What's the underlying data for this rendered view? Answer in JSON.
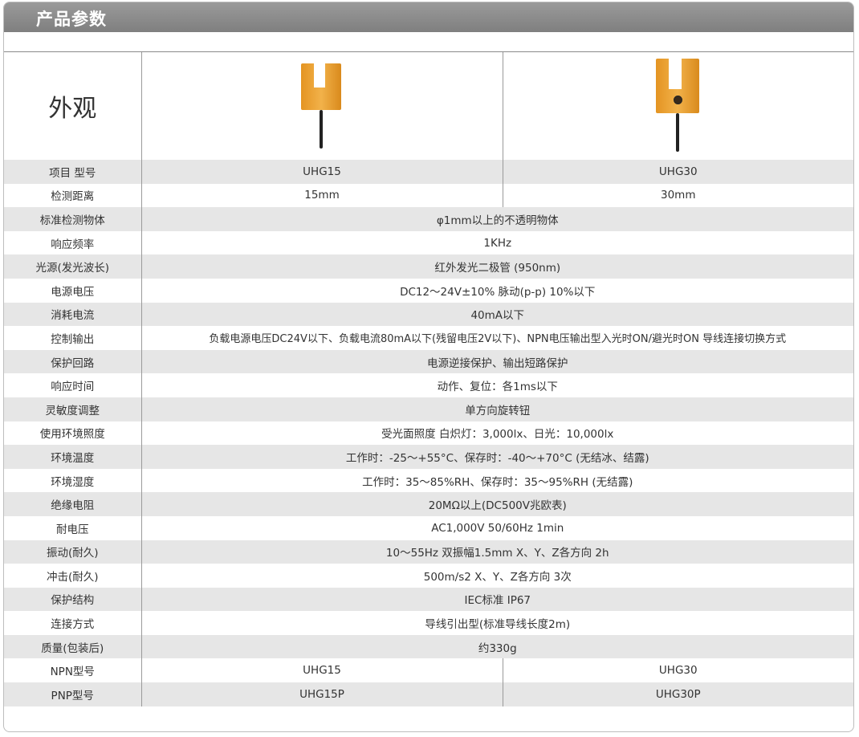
{
  "header": {
    "title": "产品参数"
  },
  "appearance": {
    "label": "外观",
    "product1_image": "u-slot-sensor-uhg15",
    "product2_image": "u-slot-sensor-uhg30"
  },
  "rows_split": [
    {
      "label": "项目 型号",
      "a": "UHG15",
      "b": "UHG30"
    },
    {
      "label": "检测距离",
      "a": "15mm",
      "b": "30mm"
    }
  ],
  "rows_full": [
    {
      "label": "标准检测物体",
      "value": "φ1mm以上的不透明物体"
    },
    {
      "label": "响应频率",
      "value": "1KHz"
    },
    {
      "label": "光源(发光波长)",
      "value": "红外发光二极管 (950nm)"
    },
    {
      "label": "电源电压",
      "value": "DC12～24V±10% 脉动(p-p) 10%以下"
    },
    {
      "label": "消耗电流",
      "value": "40mA以下"
    },
    {
      "label": "控制输出",
      "value": "负载电源电压DC24V以下、负载电流80mA以下(残留电压2V以下)、NPN电压输出型入光时ON/避光时ON 导线连接切换方式"
    },
    {
      "label": "保护回路",
      "value": "电源逆接保护、输出短路保护"
    },
    {
      "label": "响应时间",
      "value": "动作、复位：各1ms以下"
    },
    {
      "label": "灵敏度调整",
      "value": "单方向旋转钮"
    },
    {
      "label": "使用环境照度",
      "value": "受光面照度 白炽灯：3,000lx、日光：10,000lx"
    },
    {
      "label": "环境温度",
      "value": "工作时：-25～+55°C、保存时：-40～+70°C (无结冰、结露)"
    },
    {
      "label": "环境湿度",
      "value": "工作时：35～85%RH、保存时：35～95%RH (无结露)"
    },
    {
      "label": "绝缘电阻",
      "value": "20MΩ以上(DC500V兆欧表)"
    },
    {
      "label": "耐电压",
      "value": "AC1,000V 50/60Hz 1min"
    },
    {
      "label": "振动(耐久)",
      "value": "10～55Hz 双振幅1.5mm X、Y、Z各方向 2h"
    },
    {
      "label": "冲击(耐久)",
      "value": "500m/s2 X、Y、Z各方向 3次"
    },
    {
      "label": "保护结构",
      "value": "IEC标准 IP67"
    },
    {
      "label": "连接方式",
      "value": "导线引出型(标准导线长度2m)"
    },
    {
      "label": "质量(包装后)",
      "value": "约330g"
    }
  ],
  "rows_models": [
    {
      "label": "NPN型号",
      "a": "UHG15",
      "b": "UHG30"
    },
    {
      "label": "PNP型号",
      "a": "UHG15P",
      "b": "UHG30P"
    }
  ],
  "colors": {
    "header_bg": "#8a8a8a",
    "row_alt": "#e6e6e6",
    "sensor_orange": "#e9a032"
  }
}
